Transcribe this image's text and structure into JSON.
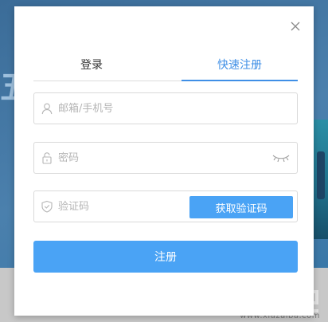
{
  "background": {
    "deco_text": "五",
    "watermark_text": "www.xiazaiba.com",
    "watermark_logo": "下载吧"
  },
  "dialog": {
    "close_icon": "close-icon",
    "tabs": [
      {
        "label": "登录",
        "active": false
      },
      {
        "label": "快速注册",
        "active": true
      }
    ],
    "email": {
      "placeholder": "邮箱/手机号",
      "value": "",
      "icon": "user-icon"
    },
    "password": {
      "placeholder": "密码",
      "value": "",
      "icon": "lock-icon",
      "toggle_icon": "eye-closed-icon"
    },
    "code": {
      "placeholder": "验证码",
      "value": "",
      "icon": "shield-icon",
      "button_label": "获取验证码"
    },
    "submit_label": "注册"
  },
  "colors": {
    "accent": "#3f8fe6",
    "button": "#4aa3f5",
    "border": "#d9d9d9"
  }
}
